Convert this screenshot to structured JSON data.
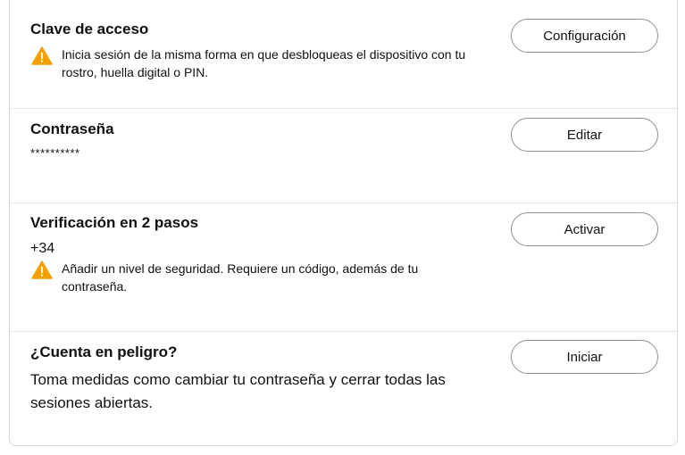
{
  "sections": [
    {
      "title": "Clave de acceso",
      "warning": "Inicia sesión de la misma forma en que desbloqueas el dispositivo con tu rostro, huella digital o PIN.",
      "button": "Configuración"
    },
    {
      "title": "Contraseña",
      "value": "**********",
      "button": "Editar"
    },
    {
      "title": "Verificación en 2 pasos",
      "value": "+34",
      "warning": "Añadir un nivel de seguridad. Requiere un código, además de tu contraseña.",
      "button": "Activar"
    },
    {
      "title": "¿Cuenta en peligro?",
      "text": "Toma medidas como cambiar tu contraseña y cerrar todas las sesiones abiertas.",
      "button": "Iniciar"
    }
  ],
  "colors": {
    "warning": "#f4a000",
    "border": "#d5d9d9",
    "text": "#0f1111"
  }
}
